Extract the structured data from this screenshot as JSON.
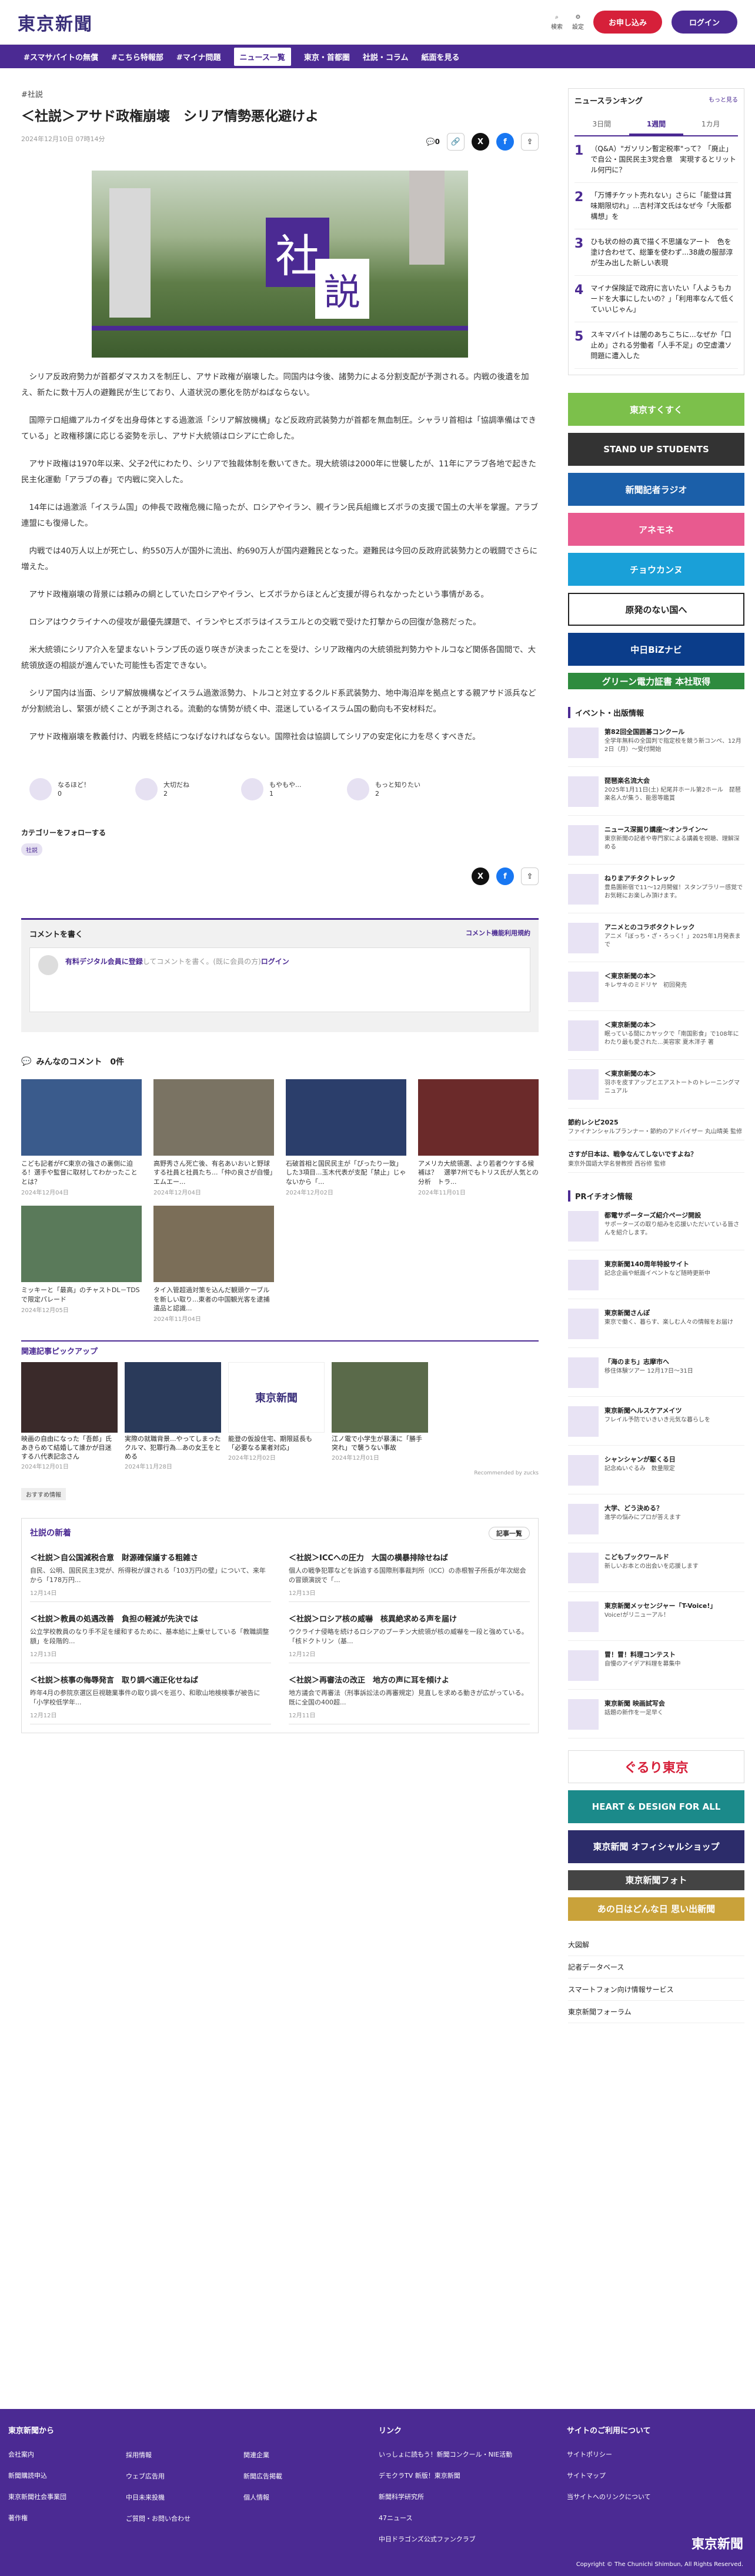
{
  "header": {
    "logo": "東京新聞",
    "search": "検索",
    "settings": "設定",
    "signup": "お申し込み",
    "login": "ログイン"
  },
  "nav": [
    "#スマサバイトの無償",
    "#こちら特報部",
    "#マイナ問題",
    "ニュース一覧",
    "東京・首都圏",
    "社説・コラム",
    "紙面を見る"
  ],
  "article": {
    "tag": "#社説",
    "title": "＜社説＞アサド政権崩壊　シリア情勢悪化避けよ",
    "date": "2024年12月10日 07時14分",
    "comment_count": "0",
    "photo_k1": "社",
    "photo_k2": "説",
    "paragraphs": [
      "シリア反政府勢力が首都ダマスカスを制圧し、アサド政権が崩壊した。同国内は今後、諸勢力による分割支配が予測される。内戦の後遺を加え、新たに数十万人の避難民が生じており、人道状況の悪化を防がねばならない。",
      "国際テロ組織アルカイダを出身母体とする過激派「シリア解放機構」など反政府武装勢力が首都を無血制圧。シャラリ首相は「協調準備はできている」と政権移譲に応じる姿勢を示し、アサド大統領はロシアに亡命した。",
      "アサド政権は1970年以来、父子2代にわたり、シリアで独裁体制を敷いてきた。現大統領は2000年に世襲したが、11年にアラブ各地で起きた民主化運動「アラブの春」で内戦に突入した。",
      "14年には過激派「イスラム国」の伸長で政権危機に陥ったが、ロシアやイラン、親イラン民兵組織ヒズボラの支援で国土の大半を掌握。アラブ連盟にも復帰した。",
      "内戦では40万人以上が死亡し、約550万人が国外に流出、約690万人が国内避難民となった。避難民は今回の反政府武装勢力との戦闘でさらに増えた。",
      "アサド政権崩壊の背景には頼みの綱としていたロシアやイラン、ヒズボラからほとんど支援が得られなかったという事情がある。",
      "ロシアはウクライナへの侵攻が最優先課題で、イランやヒズボラはイスラエルとの交戦で受けた打撃からの回復が急務だった。",
      "米大統領にシリア介入を望まないトランプ氏の返り咲きが決まったことを受け、シリア政権内の大統領批判勢力やトルコなど関係各国間で、大統領放逐の相談が進んでいた可能性も否定できない。",
      "シリア国内は当面、シリア解放機構などイスラム過激派勢力、トルコと対立するクルド系武装勢力、地中海沿岸を拠点とする親アサド派兵などが分割統治し、緊張が続くことが予測される。流動的な情勢が続く中、混迷しているイスラム国の動向も不安材料だ。",
      "アサド政権崩壊を教義付け、内戦を終結につなげなければならない。国際社会は協調してシリアの安定化に力を尽くすべきだ。"
    ],
    "reactions": [
      {
        "label": "なるほど！",
        "n": "0"
      },
      {
        "label": "大切だね",
        "n": "2"
      },
      {
        "label": "もやもや...",
        "n": "1"
      },
      {
        "label": "もっと知りたい",
        "n": "2"
      }
    ],
    "follow_label": "カテゴリーをフォローする",
    "follow_badge": "社説"
  },
  "comment": {
    "title": "コメントを書く",
    "rule": "コメント機能利用規約",
    "hint_b": "有料デジタル会員に登録",
    "hint": "してコメントを書く。(既に会員の方)",
    "login": "ログイン"
  },
  "comments_header": "みんなのコメント　0件",
  "related": [
    {
      "c": "こども記者がFC東京の強さの裏側に迫る！選手や監督に取材してわかったこととは？",
      "d": "2024年12月04日"
    },
    {
      "c": "高野秀さん死亡後、有名あいおいと野球する社員と社員たち...「仲の良さが自慢」エムエー...",
      "d": "2024年12月04日"
    },
    {
      "c": "石破首相と国民民主が「ぴったり一致」した3項目...玉木代表が支配「禁止」じゃないから「...",
      "d": "2024年12月02日"
    },
    {
      "c": "アメリカ大統領選、より若者ウケする候補は？　選挙7州でもトリス氏が人気との分析　トラ...",
      "d": "2024年11月01日"
    },
    {
      "c": "ミッキーと「最高」のチャストDL－TDSで限定パレード",
      "d": "2024年12月05日"
    },
    {
      "c": "タイ入管超過対策を込んだ観頭ケーブルを新しい取り...東者の中国観光客を逮捕　遺品と認識...",
      "d": "2024年11月04日"
    }
  ],
  "pickup_title": "関連記事ピックアップ",
  "pickup": [
    {
      "c": "映画の自由になった「吾郎」氏　あきらめて結婚して誰かが目迷する八代表記念さん",
      "d": "2024年12月01日"
    },
    {
      "c": "実際の就職背景...やってしまったクルマ、犯罪行為...あの女王をとめる",
      "d": "2024年11月28日"
    },
    {
      "c": "能登の仮設住宅、期限延長も「必要なる業者対応」",
      "d": "2024年12月02日"
    },
    {
      "c": "江ノ電で小学生が暴漢に「勝手突れ」で襲うない事故",
      "d": "2024年12月01日"
    }
  ],
  "pickup_logo": "東京新聞",
  "pickup_by": "Recommended by zucks",
  "pickup_badge": "おすすめ情報",
  "latest": {
    "title": "社説の新着",
    "more": "記事一覧",
    "items": [
      {
        "t": "＜社説＞自公国減税合意　財源確保議する粗雑さ",
        "s": "自民、公明、国民民主3党が、所得税が課される「103万円の壁」について、来年から「178万円...",
        "d": "12月14日"
      },
      {
        "t": "＜社説＞ICCへの圧力　大国の横暴排除せねば",
        "s": "個人の戦争犯罪などを訴追する国際刑事裁判所（ICC）の赤根智子所長が年次総会の冒頭演説で「...",
        "d": "12月13日"
      },
      {
        "t": "＜社説＞教員の処遇改善　負担の軽減が先決では",
        "s": "公立学校教員のなり手不足を緩和するために、基本給に上乗せしている「教職調整額」を段階的...",
        "d": "12月13日"
      },
      {
        "t": "＜社説＞ロシア核の威嚇　核異絶求める声を届け",
        "s": "ウクライナ侵略を続けるロシアのプーチン大統領が核の威嚇を一段と強めている。「核ドクトリン（基...",
        "d": "12月12日"
      },
      {
        "t": "＜社説＞核事の侮辱発言　取り調べ適正化せねば",
        "s": "昨年4月の参院京選区巨視聴業事件の取り調べを巡り、和歌山地検検事が被告に「小学校低学年...",
        "d": "12月12日"
      },
      {
        "t": "＜社説＞再審法の改正　地方の声に耳を傾けよ",
        "s": "地方議会で再審法（刑事訴訟法の再審規定）見直しを求める動きが広がっている。既に全国の400超...",
        "d": "12月11日"
      }
    ]
  },
  "ranking": {
    "title": "ニュースランキング",
    "more": "もっと見る",
    "tabs": [
      "3日間",
      "1週間",
      "1カ月"
    ],
    "items": [
      {
        "n": "1",
        "t": "（Q&A）\"ガソリン暫定税率\"って？「廃止」で自公・国民民主3党合意　実現するとリットル何円に？"
      },
      {
        "n": "2",
        "t": "「万博チケット売れない」さらに「能登は賞味期限切れ」...吉村洋文氏はなぜ今「大阪都構想」を"
      },
      {
        "n": "3",
        "t": "ひも状の紛の真で描く不思議なアート　色を塗け合わせて、総筆を使わず...38歳の服部淳が生み出した新しい表現"
      },
      {
        "n": "4",
        "t": "マイナ保険証で政府に言いたい「人ようもカードを大事にしたいの？」「利用率なんて低くていいじゃん」"
      },
      {
        "n": "5",
        "t": "スキマバイトは闇のあちこちに...なぜか「口止め」される労働者「人手不足」の空虚濃ソ問題に遭入した"
      }
    ]
  },
  "banners": [
    {
      "t": "東京すくすく",
      "c": "#7cc04b"
    },
    {
      "t": "STAND UP STUDENTS",
      "c": "#333"
    },
    {
      "t": "新聞記者ラジオ",
      "c": "#1b5fa9"
    },
    {
      "t": "アネモネ",
      "c": "#e85a8f"
    },
    {
      "t": "チョウカンヌ",
      "c": "#1aa0d8"
    },
    {
      "t": "原発のない国へ",
      "c": "#222"
    },
    {
      "t": "中日BiZナビ",
      "c": "#0b3d8a"
    },
    {
      "t": "グリーン電力証書 本社取得",
      "c": "#2e8b3e"
    }
  ],
  "events": {
    "title": "イベント・出版情報",
    "items": [
      {
        "t": "第82回全国囲碁コンクール",
        "s": "全学年無料の全国判で指定校を競う新コンペ、12月2日（月）～受付開始"
      },
      {
        "t": "琵琶楽名流大会",
        "s": "2025年1月11日(土) 紀尾井ホール第2ホール　琵琶楽名人が集う、能恩等鑑賞"
      },
      {
        "t": "ニュース深掘り講座～オンライン～",
        "s": "東京新聞の記者や専門家による講義を視聴、理解深める"
      },
      {
        "t": "ねりまアチタクトレック",
        "s": "豊島園新宿で11～12月開催！スタンプラリー感覚でお気軽にお楽しみ頂けます。"
      },
      {
        "t": "アニメとのコラボタクトレック",
        "s": "アニメ「ぼっち・ざ・ろっく！」2025年1月発表まで"
      },
      {
        "t": "＜東京新聞の本＞",
        "s": "キレサキのミドリヤ　初回発売"
      },
      {
        "t": "＜東京新聞の本＞",
        "s": "眠っている間にカヤックで「南国影食」で108年にわたり最も愛された...美容家 夏木洋子 著"
      },
      {
        "t": "＜東京新聞の本＞",
        "s": "羽ホを皮すアップとエアストートのトレーニングマニュアル"
      },
      {
        "t": "節約レシピ2025",
        "s": "ファイナンシャルプランナー・節約のアドバイザー 丸山晴美 監修"
      },
      {
        "t": "さすが日本は、戦争なんてしないですよね？",
        "s": "東京外国語大学名誉教授 西谷修 監修"
      }
    ]
  },
  "pr": {
    "title": "PRイチオシ情報",
    "items": [
      {
        "t": "都電サポーターズ紹介ページ開設",
        "s": "サポーターズの取り組みを応援いただいている皆さんを紹介します。"
      },
      {
        "t": "東京新聞140周年特設サイト",
        "s": "記念企画や紙面イベントなど随時更新中"
      },
      {
        "t": "東京新聞さんぽ",
        "s": "東京で働く、暮らす、楽しむ人々の情報をお届け"
      },
      {
        "t": "「海のまち」志摩市へ",
        "s": "移住体験ツアー 12月17日～31日"
      },
      {
        "t": "東京新聞ヘルスケアメイツ",
        "s": "フレイル予防でいきいき元気な暮らしを"
      },
      {
        "t": "シャンシャンが駆くる日",
        "s": "記念ぬいぐるみ　数量限定"
      },
      {
        "t": "大学、どう決める？",
        "s": "進学の悩みにプロが答えます"
      },
      {
        "t": "こどもブックワールド",
        "s": "新しいお本との出会いを応援します"
      },
      {
        "t": "東京新聞メッセンジャー「T-Voice!」",
        "s": "Voice!がリニューアル！"
      },
      {
        "t": "冒！冒！料理コンテスト",
        "s": "自慢のアイデア料理を募集中"
      },
      {
        "t": "東京新聞 映画試写会",
        "s": "話題の新作を一足早く"
      }
    ]
  },
  "bottom_banners": [
    {
      "t": "ぐるり東京",
      "c": "#fff"
    },
    {
      "t": "HEART & DESIGN FOR ALL",
      "c": "#1b8a8a"
    },
    {
      "t": "東京新聞 オフィシャルショップ",
      "c": "#2c2c6a"
    },
    {
      "t": "東京新聞フォト",
      "c": "#444"
    },
    {
      "t": "あの日はどんな日 思い出新聞",
      "c": "#c9a23a"
    }
  ],
  "side_links": [
    "大図解",
    "記者データベース",
    "スマートフォン向け情報サービス",
    "東京新聞フォーラム"
  ],
  "footer": {
    "cols": [
      {
        "h": "東京新聞から",
        "items": [
          "会社案内",
          "新聞購読申込",
          "東京新聞社会事業団",
          "著作権"
        ]
      },
      {
        "h": "",
        "items": [
          "採用情報",
          "ウェブ広告用",
          "中日未来投機",
          "ご質問・お問い合わせ"
        ]
      },
      {
        "h": "",
        "items": [
          "関連企業",
          "新聞広告掲載",
          "個人情報"
        ]
      },
      {
        "h": "リンク",
        "items": [
          "いっしょに読もう！新聞コンクール・NIE活動",
          "デモクラTV 新版！東京新聞",
          "新聞科学研究所",
          "47ニュース",
          "中日ドラゴンズ公式ファンクラブ"
        ]
      },
      {
        "h": "サイトのご利用について",
        "items": [
          "サイトポリシー",
          "サイトマップ",
          "当サイトへのリンクについて"
        ]
      }
    ],
    "logo": "東京新聞",
    "copy": "Copyright © The Chunichi Shimbun, All Rights Reserved."
  }
}
